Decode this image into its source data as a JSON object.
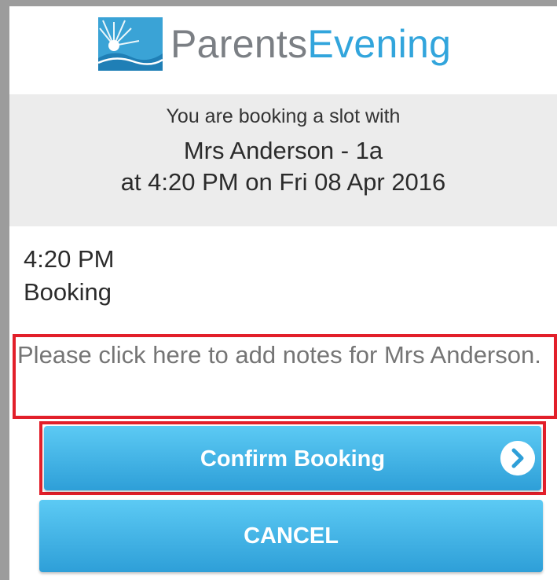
{
  "header": {
    "logo_part1": "Parents",
    "logo_part2": "Evening",
    "brand_blue": "#32a5dc",
    "brand_grey": "#7b7f84"
  },
  "booking": {
    "intro": "You are booking a slot with",
    "teacher": "Mrs Anderson - 1a",
    "datetime": "at 4:20 PM on Fri 08 Apr 2016"
  },
  "slot": {
    "time": "4:20 PM",
    "status": "Booking"
  },
  "notes": {
    "placeholder": "Please click here to add notes for Mrs Anderson."
  },
  "actions": {
    "confirm_label": "Confirm Booking",
    "cancel_label": "CANCEL",
    "button_color": "#3fb1e6",
    "highlight_color": "#e21f2a"
  }
}
